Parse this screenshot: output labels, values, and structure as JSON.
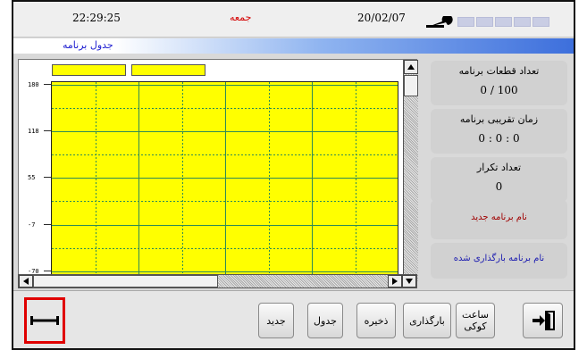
{
  "status": {
    "time": "22:29:25",
    "day": "جمعه",
    "date": "20/02/07",
    "settings_icon": "wrench-icon",
    "indicator_count": 5,
    "indicator_color": "#c9cde4"
  },
  "window": {
    "title": "جدول برنامه"
  },
  "chart_data": {
    "type": "line",
    "series": [],
    "y_tick_labels": [
      "180",
      "118",
      "55",
      "-7",
      "-70"
    ],
    "ylim": [
      -70,
      180
    ],
    "grid": true,
    "plot_background": "#ffff00",
    "legend_boxes": 2
  },
  "info_panels": {
    "segments": {
      "label": "تعداد قطعات برنامه",
      "value": "0   / 100"
    },
    "approx_time": {
      "label": "زمان تقریبی برنامه",
      "value": "0  : 0 : 0"
    },
    "repeat": {
      "label": "تعداد تکرار",
      "value": "0"
    },
    "new_program": {
      "label": "نام برنامه جدید"
    },
    "loaded_program": {
      "label": "نام برنامه بارگذاری شده"
    }
  },
  "toolbar": {
    "new": "جدید",
    "table": "جدول",
    "save": "ذخیره",
    "load": "بارگذاری",
    "clock_line1": "ساعت",
    "clock_line2": "کوکی",
    "exit_icon": "exit-door-icon",
    "range_icon": "horizontal-range-icon",
    "highlight_color": "#e00000"
  }
}
